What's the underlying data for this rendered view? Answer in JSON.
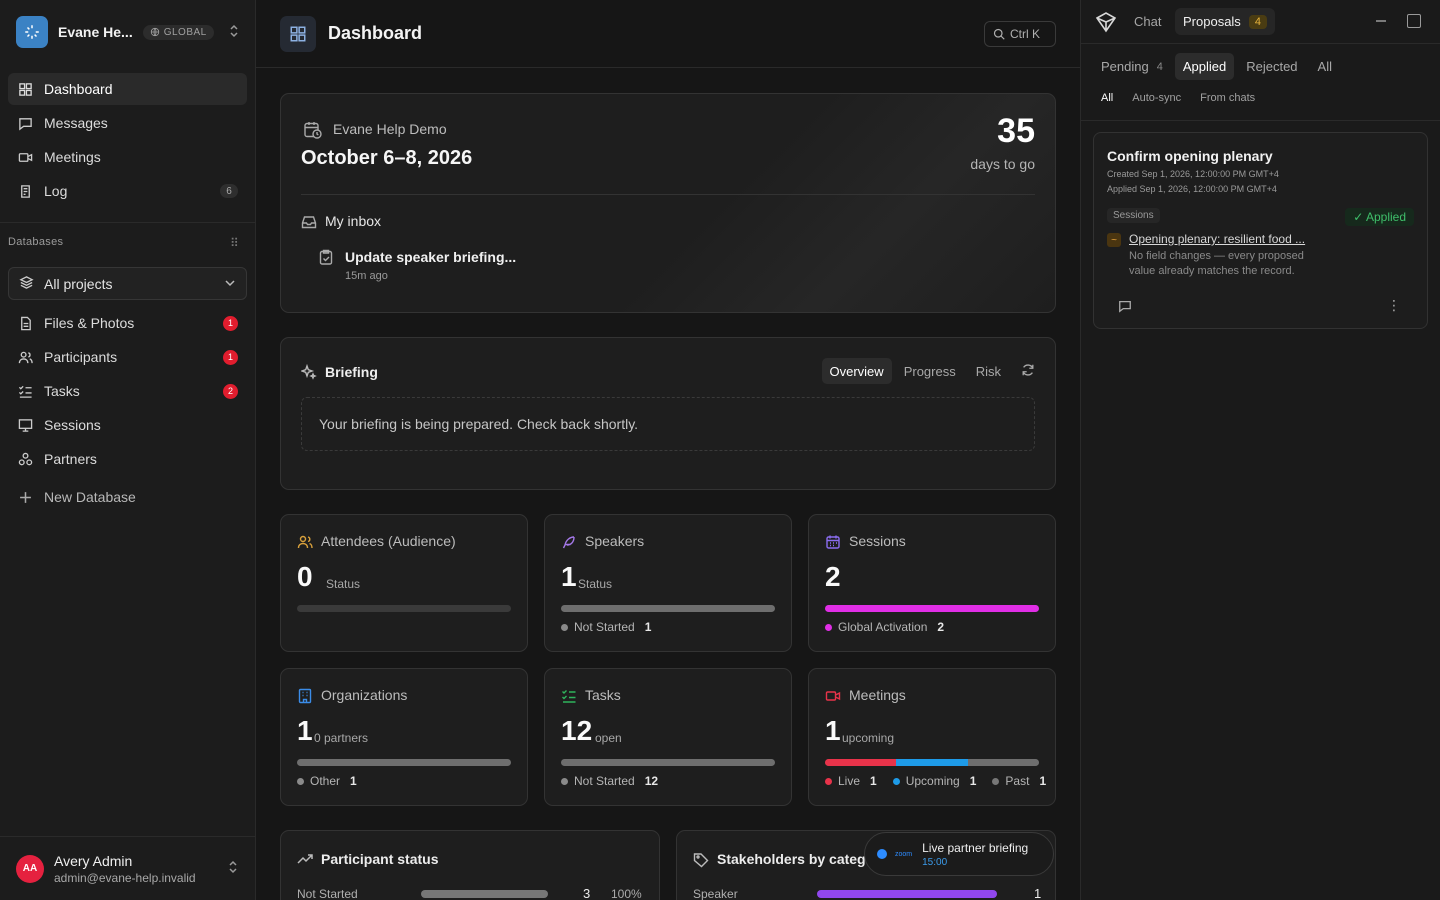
{
  "workspace": {
    "name": "Evane He...",
    "badge": "GLOBAL"
  },
  "nav": [
    {
      "label": "Dashboard"
    },
    {
      "label": "Messages"
    },
    {
      "label": "Meetings"
    },
    {
      "label": "Log",
      "count": "6"
    }
  ],
  "databases": {
    "title": "Databases",
    "selector": "All projects",
    "items": [
      {
        "label": "Files & Photos",
        "badge": "1"
      },
      {
        "label": "Participants",
        "badge": "1"
      },
      {
        "label": "Tasks",
        "badge": "2"
      },
      {
        "label": "Sessions"
      },
      {
        "label": "Partners"
      }
    ],
    "new_label": "New Database"
  },
  "user": {
    "initials": "AA",
    "name": "Avery Admin",
    "email": "admin@evane-help.invalid"
  },
  "header": {
    "title": "Dashboard",
    "search_shortcut": "Ctrl K"
  },
  "event": {
    "name": "Evane Help Demo",
    "dates": "October 6–8, 2026",
    "days": "35",
    "days_label": "days to go",
    "inbox_title": "My inbox",
    "inbox_item": "Update speaker briefing...",
    "inbox_time": "15m ago"
  },
  "briefing": {
    "title": "Briefing",
    "tabs": [
      "Overview",
      "Progress",
      "Risk"
    ],
    "message": "Your briefing is being prepared. Check back shortly."
  },
  "stats": [
    {
      "label": "Attendees (Audience)",
      "value": "0",
      "sub": "Status",
      "color": "#d9a13c"
    },
    {
      "label": "Speakers",
      "value": "1",
      "sub": "Status",
      "color": "#a478e8",
      "legend": [
        {
          "name": "Not Started",
          "count": "1",
          "color": "#8a8a8a"
        }
      ]
    },
    {
      "label": "Sessions",
      "value": "2",
      "sub": "",
      "color": "#8b6df0",
      "legend": [
        {
          "name": "Global Activation",
          "count": "2",
          "color": "#e02ee6"
        }
      ]
    },
    {
      "label": "Organizations",
      "value": "1",
      "sub": "0 partners",
      "color": "#3b8ce8",
      "legend": [
        {
          "name": "Other",
          "count": "1",
          "color": "#8a8a8a"
        }
      ]
    },
    {
      "label": "Tasks",
      "value": "12",
      "sub": "open",
      "color": "#2fb35c",
      "legend": [
        {
          "name": "Not Started",
          "count": "12",
          "color": "#8a8a8a"
        }
      ]
    },
    {
      "label": "Meetings",
      "value": "1",
      "sub": "upcoming",
      "color": "#e8334a",
      "legend": [
        {
          "name": "Live",
          "count": "1",
          "color": "#e8334a"
        },
        {
          "name": "Upcoming",
          "count": "1",
          "color": "#1e9be8"
        },
        {
          "name": "Past",
          "count": "1",
          "color": "#777777"
        }
      ]
    }
  ],
  "participant_status": {
    "title": "Participant status",
    "row_label": "Not Started",
    "count": "3",
    "percent": "100%"
  },
  "stakeholders": {
    "title": "Stakeholders by categ",
    "row_label": "Speaker",
    "count": "1"
  },
  "toast": {
    "brand": "zoom",
    "title": "Live partner briefing",
    "time": "15:00"
  },
  "panel": {
    "chat_label": "Chat",
    "proposals_label": "Proposals",
    "proposals_count": "4",
    "tabs": [
      {
        "label": "Pending",
        "count": "4"
      },
      {
        "label": "Applied"
      },
      {
        "label": "Rejected"
      },
      {
        "label": "All"
      }
    ],
    "filters": [
      "All",
      "Auto-sync",
      "From chats"
    ],
    "proposal": {
      "title": "Confirm opening plenary",
      "created": "Created Sep 1, 2026, 12:00:00 PM GMT+4",
      "applied": "Applied Sep 1, 2026, 12:00:00 PM GMT+4",
      "tag": "Sessions",
      "status": "Applied",
      "link": "Opening plenary: resilient food ...",
      "note": "No field changes — every proposed value already matches the record."
    }
  }
}
